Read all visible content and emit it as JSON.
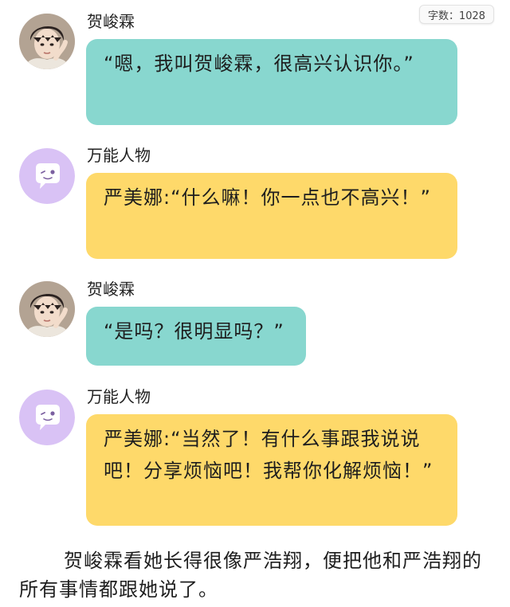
{
  "word_count": "字数：1028",
  "messages": [
    {
      "speaker": "贺峻霖",
      "text": "“嗯，我叫贺峻霖，很高兴认识你。”",
      "style": "teal",
      "avatar": "profile-photo"
    },
    {
      "speaker": "万能人物",
      "text": "严美娜:“什么嘛！你一点也不高兴！”",
      "style": "yellow",
      "avatar": "chat-bubble-icon"
    },
    {
      "speaker": "贺峻霖",
      "text": "“是吗？很明显吗？”",
      "style": "teal",
      "avatar": "profile-photo"
    },
    {
      "speaker": "万能人物",
      "text": "严美娜:“当然了！有什么事跟我说说吧！分享烦恼吧！我帮你化解烦恼！”",
      "style": "yellow",
      "avatar": "chat-bubble-icon"
    }
  ],
  "narration": "贺峻霖看她长得很像严浩翔，便把他和严浩翔的所有事情都跟她说了。",
  "colors": {
    "teal_bubble": "#88d7cf",
    "yellow_bubble": "#fed96a",
    "purple_avatar": "#d9c2f5",
    "background": "#ffffff"
  }
}
